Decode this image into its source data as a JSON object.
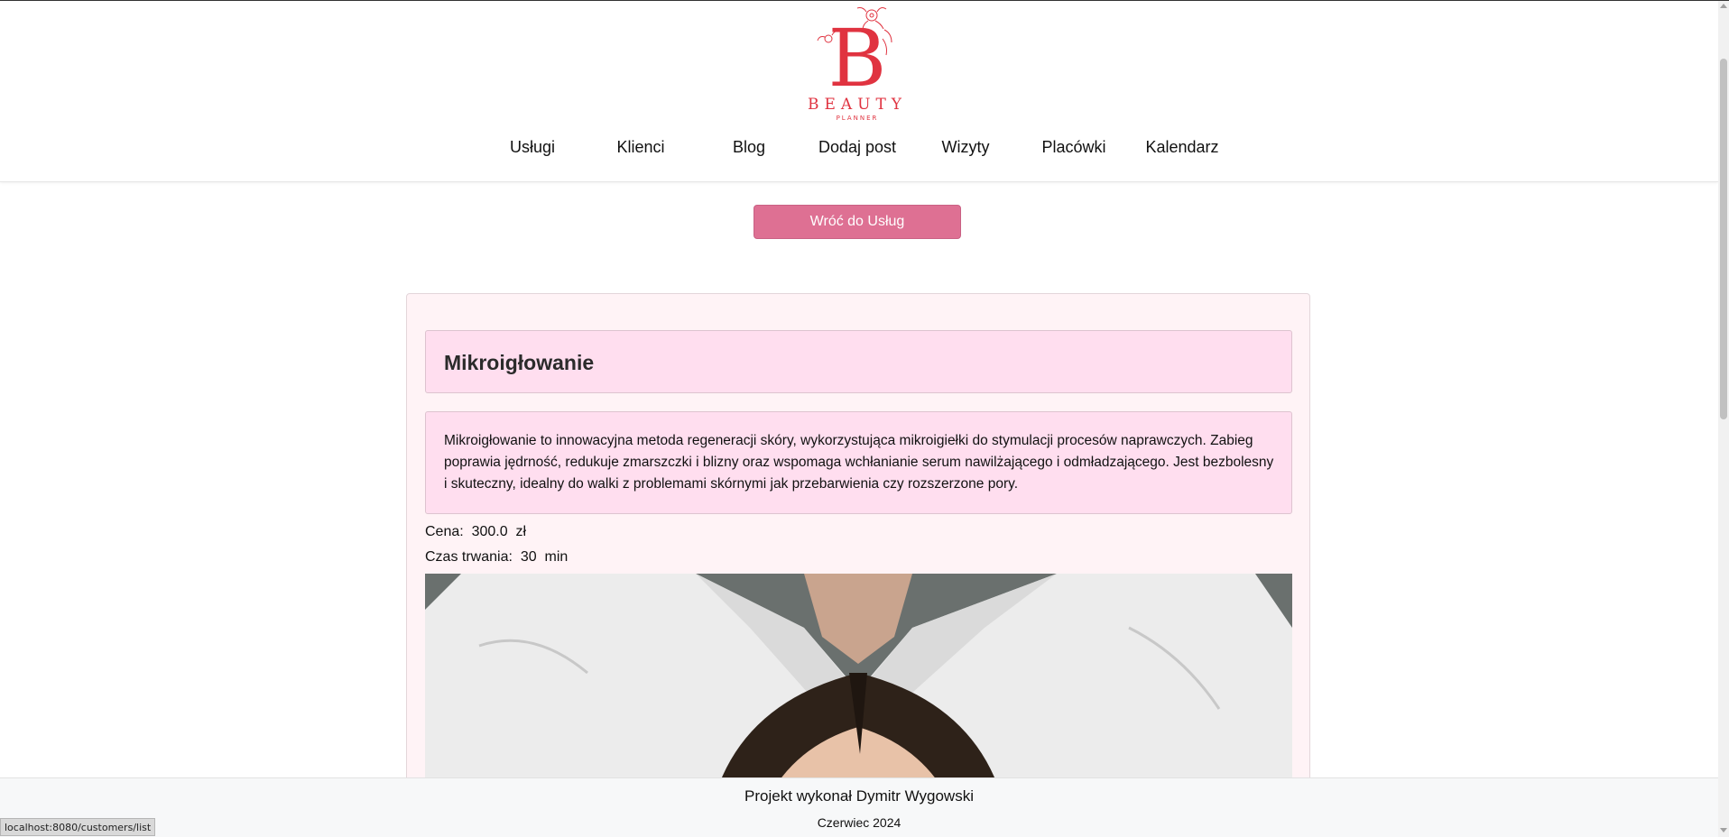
{
  "brand": {
    "name": "BEAUTY",
    "sub": "PLANNER",
    "color": "#e03340"
  },
  "nav": {
    "items": [
      "Usługi",
      "Klienci",
      "Blog",
      "Dodaj post",
      "Wizyty",
      "Placówki",
      "Kalendarz"
    ]
  },
  "actions": {
    "back_label": "Wróć do Usług"
  },
  "service": {
    "name": "Mikroigłowanie",
    "description": "Mikroigłowanie to innowacyjna metoda regeneracji skóry, wykorzystująca mikroigiełki do stymulacji procesów naprawczych. Zabieg poprawia jędrność, redukuje zmarszczki i blizny oraz wspomaga wchłanianie serum nawilżającego i odmładzającego. Jest bezbolesny i skuteczny, idealny do walki z problemami skórnymi jak przebarwienia czy rozszerzone pory.",
    "price_label": "Cena:",
    "price_value": "300.0",
    "price_unit": "zł",
    "duration_label": "Czas trwania:",
    "duration_value": "30",
    "duration_unit": "min"
  },
  "footer": {
    "author": "Projekt wykonał Dymitr Wygowski",
    "date": "Czerwiec 2024"
  },
  "status_bar": {
    "url": "localhost:8080/customers/list"
  },
  "colors": {
    "accent": "#de7093",
    "card_bg": "#fff3f6",
    "panel_bg": "#ffdeef"
  }
}
